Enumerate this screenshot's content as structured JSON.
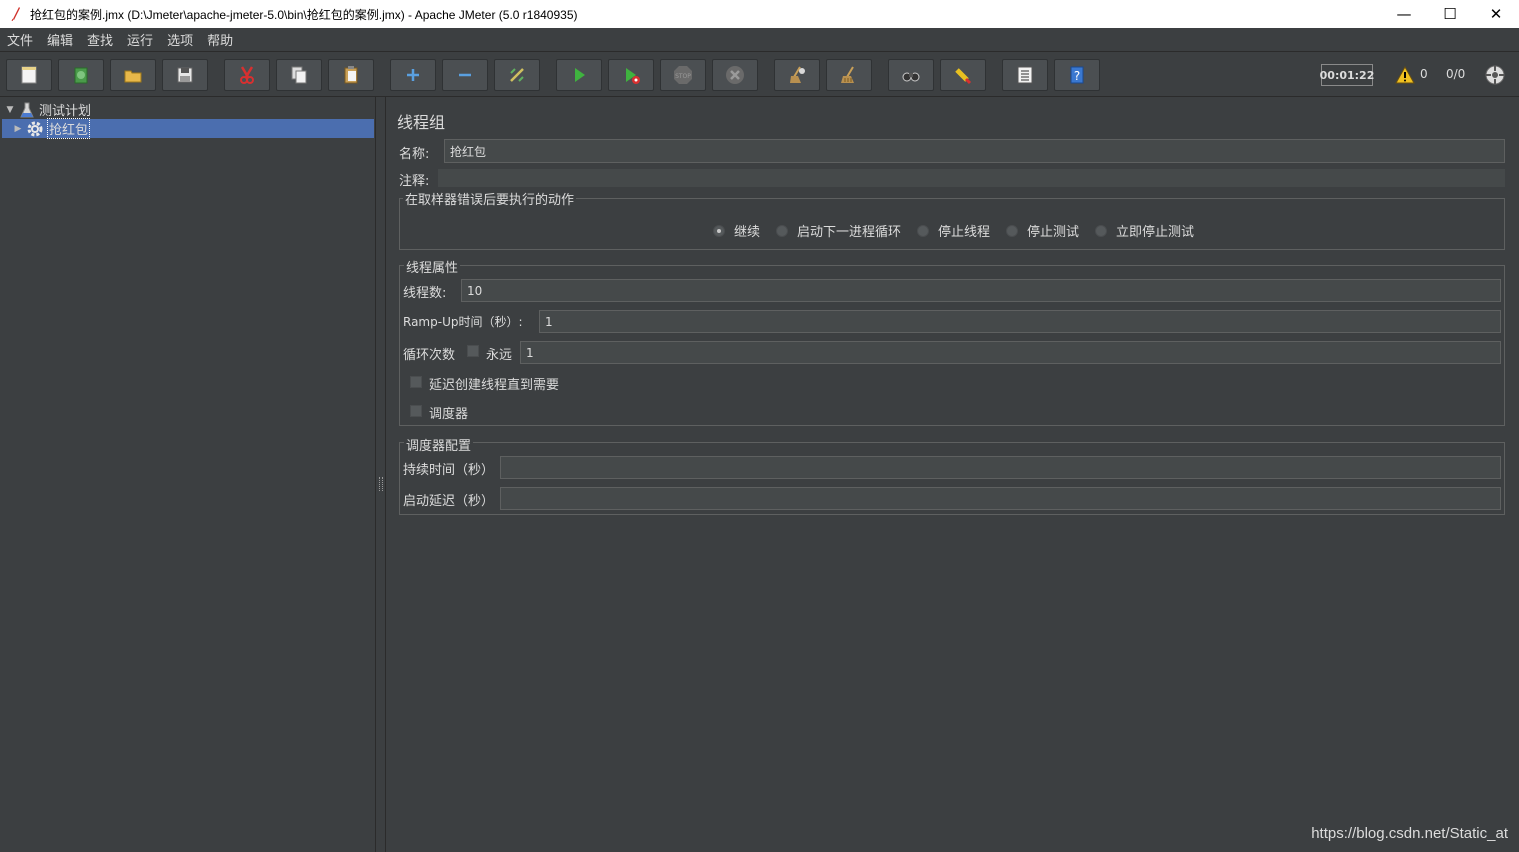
{
  "window": {
    "title": "抢红包的案例.jmx (D:\\Jmeter\\apache-jmeter-5.0\\bin\\抢红包的案例.jmx) - Apache JMeter (5.0 r1840935)",
    "minimize": "—",
    "maximize": "☐",
    "close": "✕"
  },
  "menu": [
    "文件",
    "编辑",
    "查找",
    "运行",
    "选项",
    "帮助"
  ],
  "toolbar": {
    "buttons": [
      "new-icon",
      "templates-icon",
      "open-icon",
      "save-icon",
      "cut-icon",
      "copy-icon",
      "paste-icon",
      "expand-icon",
      "collapse-icon",
      "toggle-icon",
      "start-icon",
      "start-no-pauses-icon",
      "stop-icon",
      "shutdown-icon",
      "clear-icon",
      "clear-all-icon",
      "search-icon",
      "reset-search-icon",
      "function-helper-icon",
      "help-icon"
    ],
    "timer": "00:01:22",
    "warning_count": "0",
    "thread_count": "0/0"
  },
  "tree": {
    "root": {
      "label": "测试计划",
      "expanded": true
    },
    "child": {
      "label": "抢红包",
      "selected": true
    }
  },
  "panel": {
    "title": "线程组",
    "name_label": "名称:",
    "name_value": "抢红包",
    "comment_label": "注释:",
    "comment_value": "",
    "sampler_error": {
      "title": "在取样器错误后要执行的动作",
      "options": [
        "继续",
        "启动下一进程循环",
        "停止线程",
        "停止测试",
        "立即停止测试"
      ],
      "selected": "继续"
    },
    "thread_props": {
      "title": "线程属性",
      "threads_label": "线程数:",
      "threads_value": "10",
      "rampup_label": "Ramp-Up时间（秒）:",
      "rampup_value": "1",
      "loop_label": "循环次数",
      "forever_label": "永远",
      "loop_value": "1",
      "delay_label": "延迟创建线程直到需要",
      "scheduler_label": "调度器"
    },
    "scheduler_config": {
      "title": "调度器配置",
      "duration_label": "持续时间（秒）",
      "duration_value": "",
      "startup_label": "启动延迟（秒）",
      "startup_value": ""
    }
  },
  "watermark": "https://blog.csdn.net/Static_at"
}
